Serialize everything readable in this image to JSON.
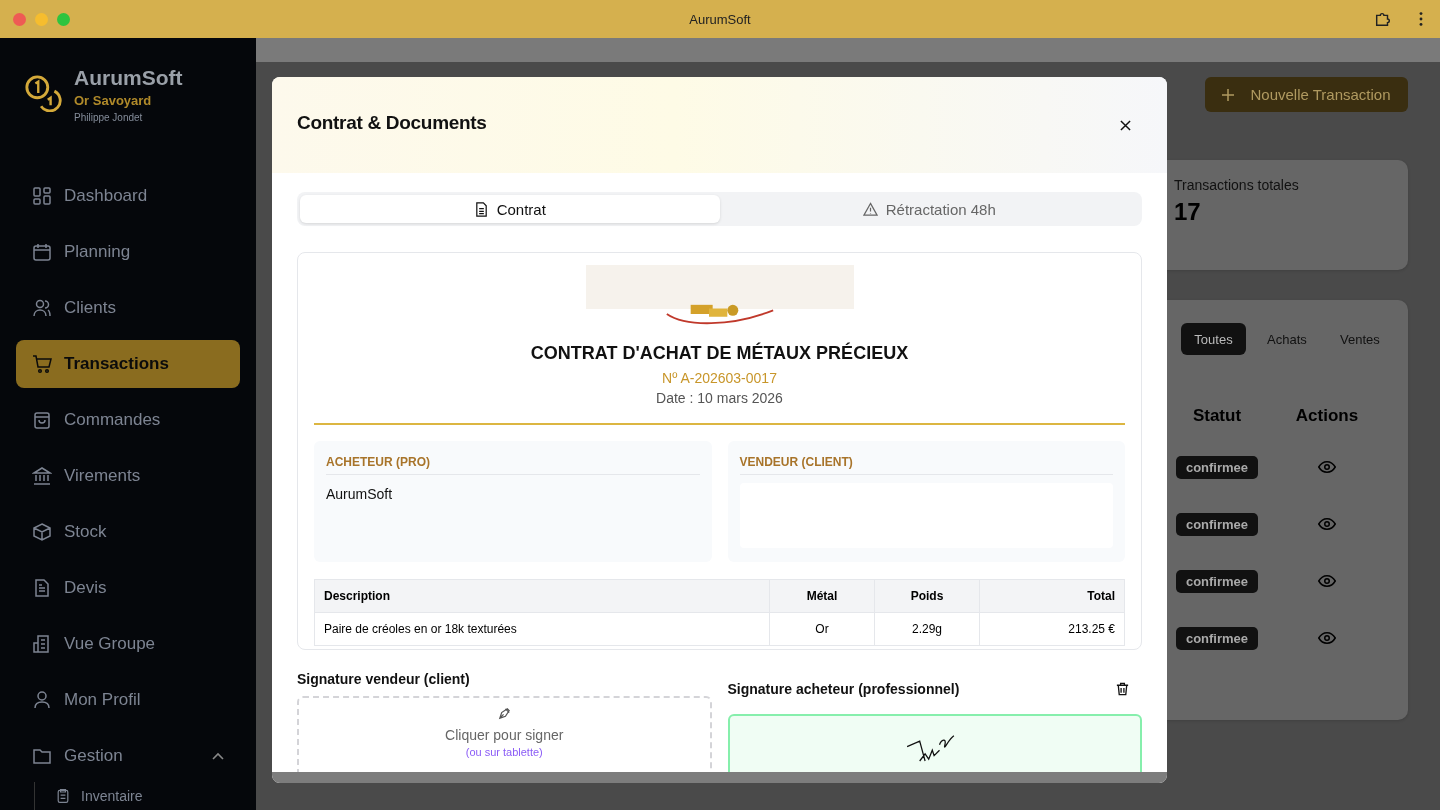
{
  "window": {
    "title": "AurumSoft"
  },
  "sidebar": {
    "brand": "AurumSoft",
    "company": "Or Savoyard",
    "user": "Philippe Jondet",
    "items": [
      {
        "label": "Dashboard",
        "selected": false
      },
      {
        "label": "Planning",
        "selected": false
      },
      {
        "label": "Clients",
        "selected": false
      },
      {
        "label": "Transactions",
        "selected": true
      },
      {
        "label": "Commandes",
        "selected": false
      },
      {
        "label": "Virements",
        "selected": false
      },
      {
        "label": "Stock",
        "selected": false
      },
      {
        "label": "Devis",
        "selected": false
      },
      {
        "label": "Vue Groupe",
        "selected": false
      },
      {
        "label": "Mon Profil",
        "selected": false
      },
      {
        "label": "Gestion",
        "selected": false,
        "expanded": true,
        "children": [
          {
            "label": "Inventaire",
            "selected": false
          }
        ]
      }
    ]
  },
  "page": {
    "new_button": "Nouvelle Transaction",
    "stat": {
      "label": "Transactions totales",
      "value": "17"
    },
    "filters": [
      {
        "label": "Toutes",
        "selected": true
      },
      {
        "label": "Achats",
        "selected": false
      },
      {
        "label": "Ventes",
        "selected": false
      }
    ],
    "columns": [
      "Statut",
      "Actions"
    ],
    "rows": [
      {
        "status": "confirmee"
      },
      {
        "status": "confirmee"
      },
      {
        "status": "confirmee"
      },
      {
        "status": "confirmee"
      }
    ]
  },
  "modal": {
    "title": "Contrat & Documents",
    "tabs": [
      {
        "label": "Contrat",
        "selected": true
      },
      {
        "label": "Rétractation 48h",
        "selected": false
      }
    ],
    "contract": {
      "title": "CONTRAT D'ACHAT DE MÉTAUX PRÉCIEUX",
      "number": "Nº A-202603-0017",
      "date": "Date : 10 mars 2026",
      "buyer": {
        "heading": "ACHETEUR (PRO)",
        "name": "AurumSoft"
      },
      "seller": {
        "heading": "VENDEUR (CLIENT)"
      },
      "columns": [
        "Description",
        "Métal",
        "Poids",
        "Total"
      ],
      "rows": [
        [
          "Paire de créoles en or 18k texturées",
          "Or",
          "2.29g",
          "213.25 €"
        ]
      ]
    },
    "seller_signature": {
      "title": "Signature vendeur (client)",
      "prompt": "Cliquer pour signer",
      "hint": "(ou sur tablette)",
      "signed": false
    },
    "buyer_signature": {
      "title": "Signature acheteur (professionnel)",
      "signed": true
    }
  }
}
